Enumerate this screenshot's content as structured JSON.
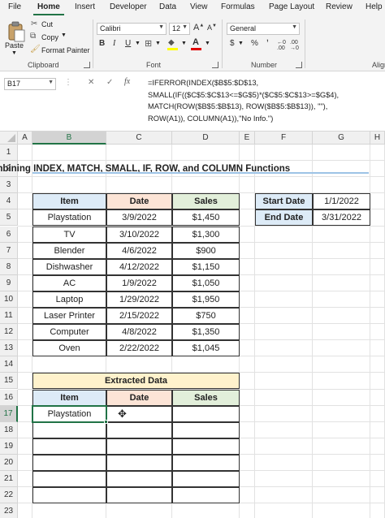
{
  "ribbon_tabs": [
    "File",
    "Home",
    "Insert",
    "Developer",
    "Data",
    "View",
    "Formulas",
    "Page Layout",
    "Review",
    "Help"
  ],
  "clipboard": {
    "paste": "Paste",
    "cut": "Cut",
    "copy": "Copy",
    "format_painter": "Format Painter",
    "label": "Clipboard"
  },
  "font": {
    "name": "Calibri",
    "size": "12",
    "label": "Font"
  },
  "number": {
    "format": "General",
    "label": "Number"
  },
  "alignment": {
    "label": "Align"
  },
  "name_box": "B17",
  "formula_icons": {
    "cancel": "✕",
    "enter": "✓",
    "fx": "fx"
  },
  "formula_lines": [
    "=IFERROR(INDEX($B$5:$D$13,",
    "SMALL(IF(($C$5:$C$13<=$G$5)*($C$5:$C$13>=$G$4),",
    "MATCH(ROW($B$5:$B$13), ROW($B$5:$B$13)), \"\"),",
    "ROW(A1)), COLUMN(A1)),\"No Info.\")"
  ],
  "column_headers": [
    "A",
    "B",
    "C",
    "D",
    "E",
    "F",
    "G",
    "H"
  ],
  "row_headers": [
    "1",
    "2",
    "3",
    "4",
    "5",
    "6",
    "7",
    "8",
    "9",
    "10",
    "11",
    "12",
    "13",
    "14",
    "15",
    "16",
    "17",
    "18",
    "19",
    "20",
    "21",
    "22",
    "23"
  ],
  "title": "Combining INDEX, MATCH, SMALL, IF, ROW, and COLUMN Functions",
  "table_headers": [
    "Item",
    "Date",
    "Sales"
  ],
  "table_rows": [
    [
      "Playstation",
      "3/9/2022",
      "$1,450"
    ],
    [
      "TV",
      "3/10/2022",
      "$1,300"
    ],
    [
      "Blender",
      "4/6/2022",
      "$900"
    ],
    [
      "Dishwasher",
      "4/12/2022",
      "$1,150"
    ],
    [
      "AC",
      "1/9/2022",
      "$1,050"
    ],
    [
      "Laptop",
      "1/29/2022",
      "$1,950"
    ],
    [
      "Laser Printer",
      "2/15/2022",
      "$750"
    ],
    [
      "Computer",
      "4/8/2022",
      "$1,350"
    ],
    [
      "Oven",
      "2/22/2022",
      "$1,045"
    ]
  ],
  "criteria": [
    {
      "label": "Start Date",
      "value": "1/1/2022"
    },
    {
      "label": "End Date",
      "value": "3/31/2022"
    }
  ],
  "extracted": {
    "title": "Extracted Data",
    "headers": [
      "Item",
      "Date",
      "Sales"
    ],
    "rows": [
      [
        "Playstation",
        "",
        ""
      ]
    ]
  },
  "colors": {
    "accent": "#217346",
    "header_blue": "#ddebf7",
    "header_peach": "#fce4d6",
    "header_green": "#e2efda",
    "header_yellow": "#fff2cc"
  }
}
